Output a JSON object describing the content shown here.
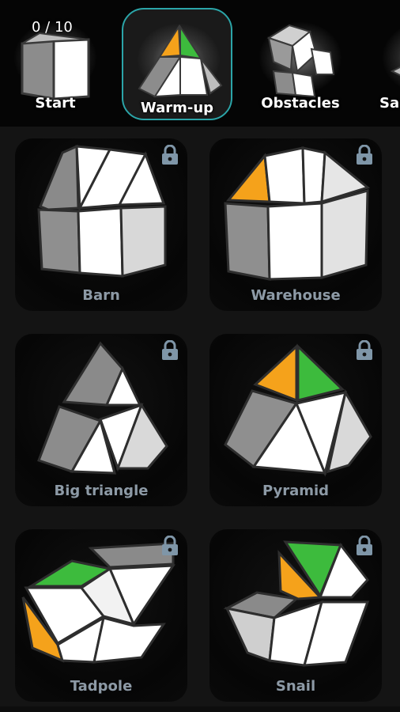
{
  "header": {
    "progress": "0 / 10",
    "categories": [
      {
        "label": "Start"
      },
      {
        "label": "Warm-up",
        "selected": true
      },
      {
        "label": "Obstacles"
      },
      {
        "label": "Sa"
      }
    ]
  },
  "puzzles": [
    {
      "name": "Barn",
      "locked": true
    },
    {
      "name": "Warehouse",
      "locked": true
    },
    {
      "name": "Big triangle",
      "locked": true
    },
    {
      "name": "Pyramid",
      "locked": true
    },
    {
      "name": "Tadpole",
      "locked": true
    },
    {
      "name": "Snail",
      "locked": true
    }
  ],
  "colors": {
    "accent": "#2ba5a8",
    "orange": "#f5a21b",
    "green": "#3dbb3d",
    "label": "#8d9aa6",
    "lock": "#7f96a8"
  },
  "icons": {
    "lock": "padlock-icon"
  }
}
